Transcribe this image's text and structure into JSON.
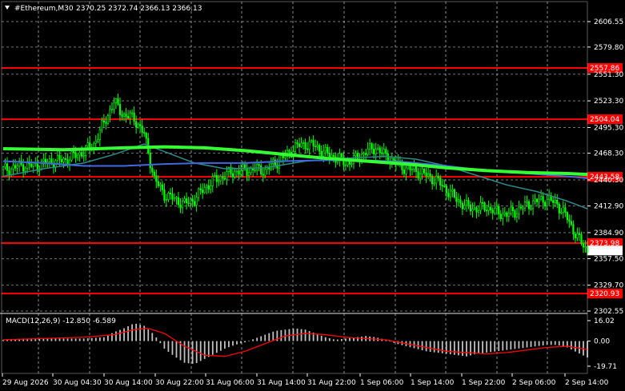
{
  "header": {
    "symbol": "#Ethereum,M30",
    "ohlc": "2370.25 2372.74 2366.13 2366.13",
    "arrow_icon": "triangle-down-icon"
  },
  "macd": {
    "label": "MACD(12,26,9) -12.850 -6.589",
    "scale": [
      "16.02",
      "0.00",
      "-19.71"
    ],
    "ylim": [
      -19.71,
      16.02
    ]
  },
  "colors": {
    "background": "#000000",
    "grid": "#ffffff",
    "candle": "#00ff00",
    "ma_fast": "#2e8b8b",
    "ma_mid": "#4169e1",
    "ma_slow": "#33ff33",
    "hline": "#ff0000",
    "macd_hist": "#c0c0c0",
    "macd_signal": "#ff0000"
  },
  "chart_data": {
    "type": "candlestick",
    "price_ylim": [
      2302.55,
      2606.55
    ],
    "price_ticks": [
      "2606.55",
      "2579.80",
      "2551.30",
      "2523.30",
      "2495.30",
      "2468.30",
      "2440.30",
      "2412.90",
      "2384.90",
      "2357.50",
      "2329.70",
      "2302.55"
    ],
    "time_ticks": [
      "29 Aug 2026",
      "30 Aug 04:30",
      "30 Aug 14:00",
      "30 Aug 22:00",
      "31 Aug 06:00",
      "31 Aug 14:00",
      "31 Aug 22:00",
      "1 Sep 06:00",
      "1 Sep 14:00",
      "1 Sep 22:00",
      "2 Sep 06:00",
      "2 Sep 14:00"
    ],
    "levels": [
      "2557.86",
      "2504.04",
      "2443.58",
      "2373.98",
      "2320.93"
    ],
    "current_price": "2366.13",
    "close_path": [
      [
        0,
        2451
      ],
      [
        5,
        2453
      ],
      [
        10,
        2456
      ],
      [
        15,
        2455
      ],
      [
        20,
        2458
      ],
      [
        25,
        2460
      ],
      [
        30,
        2461
      ],
      [
        35,
        2465
      ],
      [
        40,
        2470
      ],
      [
        45,
        2478
      ],
      [
        50,
        2500
      ],
      [
        55,
        2522
      ],
      [
        60,
        2508
      ],
      [
        65,
        2505
      ],
      [
        70,
        2488
      ],
      [
        75,
        2441
      ],
      [
        80,
        2425
      ],
      [
        85,
        2420
      ],
      [
        90,
        2415
      ],
      [
        95,
        2420
      ],
      [
        100,
        2432
      ],
      [
        105,
        2440
      ],
      [
        110,
        2445
      ],
      [
        115,
        2449
      ],
      [
        120,
        2450
      ],
      [
        125,
        2452
      ],
      [
        130,
        2450
      ],
      [
        135,
        2458
      ],
      [
        140,
        2465
      ],
      [
        145,
        2475
      ],
      [
        150,
        2478
      ],
      [
        155,
        2476
      ],
      [
        160,
        2468
      ],
      [
        165,
        2464
      ],
      [
        170,
        2458
      ],
      [
        175,
        2462
      ],
      [
        180,
        2470
      ],
      [
        185,
        2474
      ],
      [
        190,
        2465
      ],
      [
        195,
        2458
      ],
      [
        200,
        2452
      ],
      [
        205,
        2450
      ],
      [
        210,
        2445
      ],
      [
        215,
        2440
      ],
      [
        220,
        2430
      ],
      [
        225,
        2420
      ],
      [
        230,
        2412
      ],
      [
        235,
        2410
      ],
      [
        240,
        2412
      ],
      [
        245,
        2406
      ],
      [
        250,
        2404
      ],
      [
        255,
        2408
      ],
      [
        260,
        2414
      ],
      [
        265,
        2418
      ],
      [
        270,
        2420
      ],
      [
        275,
        2415
      ],
      [
        280,
        2400
      ],
      [
        285,
        2380
      ],
      [
        290,
        2366
      ]
    ],
    "ma_fast": [
      [
        0,
        2444
      ],
      [
        20,
        2452
      ],
      [
        40,
        2458
      ],
      [
        55,
        2467
      ],
      [
        70,
        2478
      ],
      [
        80,
        2470
      ],
      [
        95,
        2458
      ],
      [
        110,
        2452
      ],
      [
        130,
        2453
      ],
      [
        150,
        2460
      ],
      [
        170,
        2463
      ],
      [
        190,
        2465
      ],
      [
        205,
        2462
      ],
      [
        220,
        2455
      ],
      [
        235,
        2445
      ],
      [
        250,
        2435
      ],
      [
        265,
        2428
      ],
      [
        280,
        2418
      ],
      [
        290,
        2410
      ]
    ],
    "ma_mid": [
      [
        0,
        2460
      ],
      [
        20,
        2458
      ],
      [
        40,
        2455
      ],
      [
        60,
        2455
      ],
      [
        80,
        2457
      ],
      [
        100,
        2458
      ],
      [
        120,
        2458
      ],
      [
        140,
        2460
      ],
      [
        160,
        2461
      ],
      [
        180,
        2461
      ],
      [
        200,
        2459
      ],
      [
        220,
        2455
      ],
      [
        240,
        2450
      ],
      [
        260,
        2447
      ],
      [
        280,
        2444
      ],
      [
        290,
        2442
      ]
    ],
    "ma_slow": [
      [
        0,
        2473
      ],
      [
        30,
        2472
      ],
      [
        60,
        2474
      ],
      [
        80,
        2475
      ],
      [
        100,
        2474
      ],
      [
        120,
        2471
      ],
      [
        140,
        2467
      ],
      [
        160,
        2463
      ],
      [
        180,
        2460
      ],
      [
        200,
        2457
      ],
      [
        220,
        2453
      ],
      [
        240,
        2450
      ],
      [
        260,
        2448
      ],
      [
        280,
        2447
      ],
      [
        290,
        2446
      ]
    ],
    "macd_hist": [
      [
        0,
        1
      ],
      [
        10,
        2
      ],
      [
        20,
        2
      ],
      [
        30,
        2
      ],
      [
        40,
        2
      ],
      [
        50,
        3
      ],
      [
        55,
        7
      ],
      [
        60,
        10
      ],
      [
        65,
        14
      ],
      [
        70,
        12
      ],
      [
        75,
        5
      ],
      [
        80,
        -6
      ],
      [
        85,
        -12
      ],
      [
        90,
        -17
      ],
      [
        95,
        -18
      ],
      [
        100,
        -14
      ],
      [
        105,
        -10
      ],
      [
        110,
        -6
      ],
      [
        115,
        -3
      ],
      [
        120,
        -1
      ],
      [
        125,
        2
      ],
      [
        130,
        5
      ],
      [
        135,
        8
      ],
      [
        140,
        9
      ],
      [
        145,
        10
      ],
      [
        150,
        9
      ],
      [
        155,
        6
      ],
      [
        160,
        3
      ],
      [
        165,
        1
      ],
      [
        170,
        2
      ],
      [
        175,
        3
      ],
      [
        180,
        4
      ],
      [
        185,
        3
      ],
      [
        190,
        1
      ],
      [
        195,
        -2
      ],
      [
        200,
        -4
      ],
      [
        205,
        -6
      ],
      [
        210,
        -8
      ],
      [
        215,
        -9
      ],
      [
        220,
        -10
      ],
      [
        225,
        -11
      ],
      [
        230,
        -12
      ],
      [
        235,
        -10
      ],
      [
        240,
        -9
      ],
      [
        245,
        -8
      ],
      [
        250,
        -7
      ],
      [
        255,
        -6
      ],
      [
        260,
        -5
      ],
      [
        265,
        -4
      ],
      [
        270,
        -3
      ],
      [
        275,
        -3
      ],
      [
        280,
        -5
      ],
      [
        285,
        -9
      ],
      [
        290,
        -12.85
      ]
    ],
    "macd_signal": [
      [
        0,
        1
      ],
      [
        20,
        2
      ],
      [
        40,
        3
      ],
      [
        55,
        5
      ],
      [
        65,
        9
      ],
      [
        72,
        10
      ],
      [
        80,
        6
      ],
      [
        90,
        -4
      ],
      [
        100,
        -11
      ],
      [
        110,
        -12
      ],
      [
        120,
        -8
      ],
      [
        130,
        -2
      ],
      [
        140,
        4
      ],
      [
        150,
        6
      ],
      [
        160,
        5
      ],
      [
        170,
        3
      ],
      [
        180,
        2
      ],
      [
        190,
        1
      ],
      [
        200,
        -2
      ],
      [
        210,
        -5
      ],
      [
        220,
        -8
      ],
      [
        230,
        -9
      ],
      [
        240,
        -10
      ],
      [
        250,
        -9
      ],
      [
        260,
        -7
      ],
      [
        270,
        -5
      ],
      [
        280,
        -4
      ],
      [
        290,
        -6.589
      ]
    ]
  }
}
